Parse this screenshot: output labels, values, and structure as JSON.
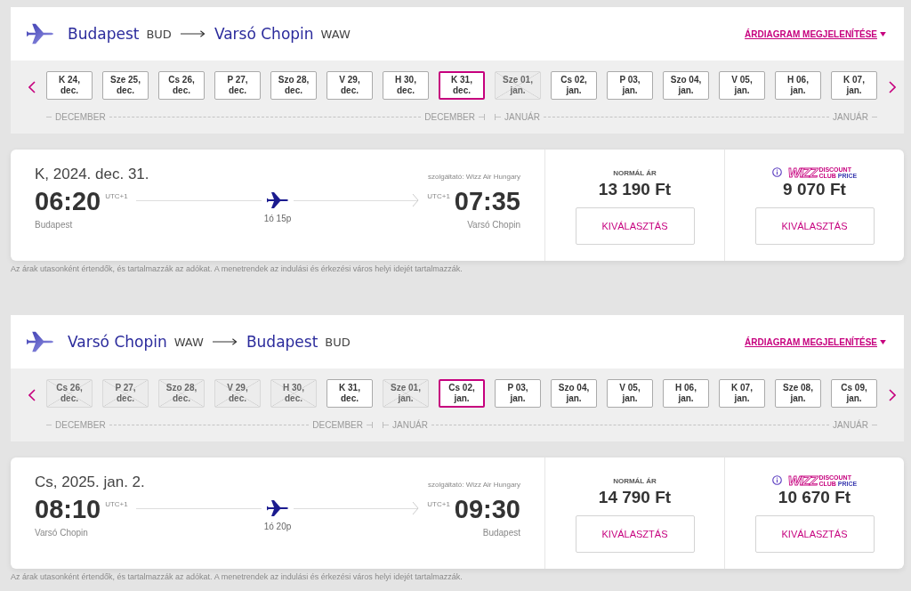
{
  "flights": [
    {
      "route": {
        "from_city": "Budapest",
        "from_code": "BUD",
        "to_city": "Varsó Chopin",
        "to_code": "WAW"
      },
      "price_chart_link": "ÁRDIAGRAM MEGJELENÍTÉSE",
      "months": [
        {
          "label_start": "DECEMBER",
          "label_end": "DECEMBER",
          "dates": [
            {
              "lines": [
                "K 24,",
                "dec."
              ],
              "selected": false,
              "disabled": false
            },
            {
              "lines": [
                "Sze 25,",
                "dec."
              ],
              "selected": false,
              "disabled": false
            },
            {
              "lines": [
                "Cs 26,",
                "dec."
              ],
              "selected": false,
              "disabled": false
            },
            {
              "lines": [
                "P 27,",
                "dec."
              ],
              "selected": false,
              "disabled": false
            },
            {
              "lines": [
                "Szo 28,",
                "dec."
              ],
              "selected": false,
              "disabled": false
            },
            {
              "lines": [
                "V 29,",
                "dec."
              ],
              "selected": false,
              "disabled": false
            },
            {
              "lines": [
                "H 30,",
                "dec."
              ],
              "selected": false,
              "disabled": false
            },
            {
              "lines": [
                "K 31,",
                "dec."
              ],
              "selected": true,
              "disabled": false
            }
          ]
        },
        {
          "label_start": "JANUÁR",
          "label_end": "JANUÁR",
          "dates": [
            {
              "lines": [
                "Sze 01,",
                "jan."
              ],
              "selected": false,
              "disabled": true
            },
            {
              "lines": [
                "Cs 02,",
                "jan."
              ],
              "selected": false,
              "disabled": false
            },
            {
              "lines": [
                "P 03,",
                "jan."
              ],
              "selected": false,
              "disabled": false
            },
            {
              "lines": [
                "Szo 04,",
                "jan."
              ],
              "selected": false,
              "disabled": false
            },
            {
              "lines": [
                "V 05,",
                "jan."
              ],
              "selected": false,
              "disabled": false
            },
            {
              "lines": [
                "H 06,",
                "jan."
              ],
              "selected": false,
              "disabled": false
            },
            {
              "lines": [
                "K 07,",
                "jan."
              ],
              "selected": false,
              "disabled": false
            }
          ]
        }
      ],
      "flight": {
        "date": "K, 2024. dec. 31.",
        "carrier": "szolgáltató: Wizz Air Hungary",
        "departure_time": "06:20",
        "departure_tz": "UTC+1",
        "departure_city": "Budapest",
        "duration": "1ó 15p",
        "arrival_tz": "UTC+1",
        "arrival_time": "07:35",
        "arrival_city": "Varsó Chopin"
      },
      "fares": [
        {
          "kind": "normal",
          "label": "NORMÁL ÁR",
          "price": "13 190 Ft",
          "button": "KIVÁLASZTÁS"
        },
        {
          "kind": "club",
          "logo": "WIZZ",
          "logo_line1": "DISCOUNT",
          "logo_line2a": "CLUB",
          "logo_line2b": "PRICE",
          "price": "9 070 Ft",
          "button": "KIVÁLASZTÁS"
        }
      ],
      "note": "Az árak utasonként értendők, és tartalmazzák az adókat. A menetrendek az indulási és érkezési város helyi idejét tartalmazzák."
    },
    {
      "route": {
        "from_city": "Varsó Chopin",
        "from_code": "WAW",
        "to_city": "Budapest",
        "to_code": "BUD"
      },
      "price_chart_link": "ÁRDIAGRAM MEGJELENÍTÉSE",
      "months": [
        {
          "label_start": "DECEMBER",
          "label_end": "DECEMBER",
          "dates": [
            {
              "lines": [
                "Cs 26,",
                "dec."
              ],
              "selected": false,
              "disabled": true
            },
            {
              "lines": [
                "P 27,",
                "dec."
              ],
              "selected": false,
              "disabled": true
            },
            {
              "lines": [
                "Szo 28,",
                "dec."
              ],
              "selected": false,
              "disabled": true
            },
            {
              "lines": [
                "V 29,",
                "dec."
              ],
              "selected": false,
              "disabled": true
            },
            {
              "lines": [
                "H 30,",
                "dec."
              ],
              "selected": false,
              "disabled": true
            },
            {
              "lines": [
                "K 31,",
                "dec."
              ],
              "selected": false,
              "disabled": false
            }
          ]
        },
        {
          "label_start": "JANUÁR",
          "label_end": "JANUÁR",
          "dates": [
            {
              "lines": [
                "Sze 01,",
                "jan."
              ],
              "selected": false,
              "disabled": true
            },
            {
              "lines": [
                "Cs 02,",
                "jan."
              ],
              "selected": true,
              "disabled": false
            },
            {
              "lines": [
                "P 03,",
                "jan."
              ],
              "selected": false,
              "disabled": false
            },
            {
              "lines": [
                "Szo 04,",
                "jan."
              ],
              "selected": false,
              "disabled": false
            },
            {
              "lines": [
                "V 05,",
                "jan."
              ],
              "selected": false,
              "disabled": false
            },
            {
              "lines": [
                "H 06,",
                "jan."
              ],
              "selected": false,
              "disabled": false
            },
            {
              "lines": [
                "K 07,",
                "jan."
              ],
              "selected": false,
              "disabled": false
            },
            {
              "lines": [
                "Sze 08,",
                "jan."
              ],
              "selected": false,
              "disabled": false
            },
            {
              "lines": [
                "Cs 09,",
                "jan."
              ],
              "selected": false,
              "disabled": false
            }
          ]
        }
      ],
      "flight": {
        "date": "Cs, 2025. jan. 2.",
        "carrier": "szolgáltató: Wizz Air Hungary",
        "departure_time": "08:10",
        "departure_tz": "UTC+1",
        "departure_city": "Varsó Chopin",
        "duration": "1ó 20p",
        "arrival_tz": "UTC+1",
        "arrival_time": "09:30",
        "arrival_city": "Budapest"
      },
      "fares": [
        {
          "kind": "normal",
          "label": "NORMÁL ÁR",
          "price": "14 790 Ft",
          "button": "KIVÁLASZTÁS"
        },
        {
          "kind": "club",
          "logo": "WIZZ",
          "logo_line1": "DISCOUNT",
          "logo_line2a": "CLUB",
          "logo_line2b": "PRICE",
          "price": "10 670 Ft",
          "button": "KIVÁLASZTÁS"
        }
      ],
      "note": "Az árak utasonként értendők, és tartalmazzák az adókat. A menetrendek az indulási és érkezési város helyi idejét tartalmazzák."
    }
  ]
}
